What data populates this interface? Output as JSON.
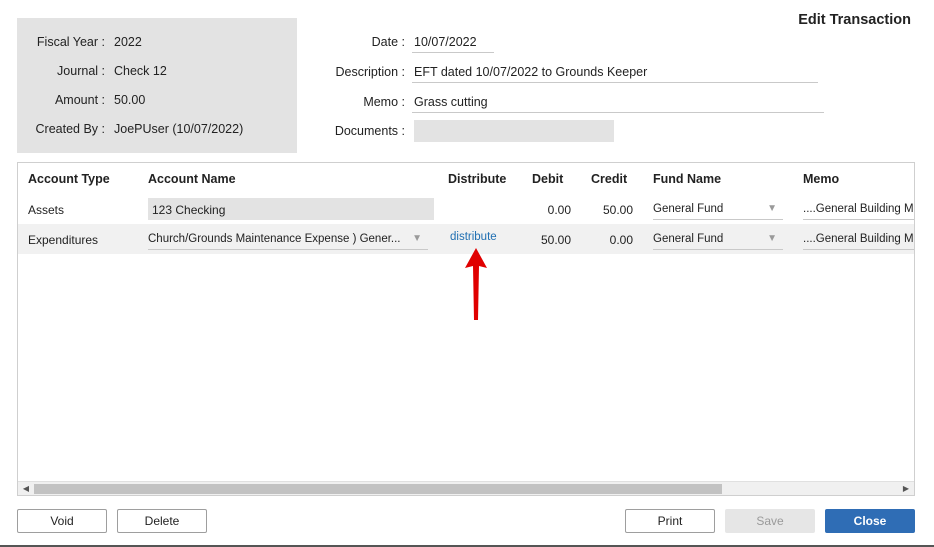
{
  "title": "Edit Transaction",
  "info": {
    "fiscal_year_label": "Fiscal Year :",
    "fiscal_year": "2022",
    "journal_label": "Journal :",
    "journal": "Check 12",
    "amount_label": "Amount :",
    "amount": "50.00",
    "created_by_label": "Created By :",
    "created_by": "JoePUser (10/07/2022)"
  },
  "form": {
    "date_label": "Date :",
    "date": "10/07/2022",
    "description_label": "Description :",
    "description": "EFT dated 10/07/2022 to Grounds Keeper",
    "memo_label": "Memo :",
    "memo": "Grass cutting",
    "documents_label": "Documents :",
    "documents": ""
  },
  "grid": {
    "columns": [
      "Account Type",
      "Account Name",
      "Distribute",
      "Debit",
      "Credit",
      "Fund Name",
      "Memo"
    ],
    "rows": [
      {
        "account_type": "Assets",
        "account_name": "123 Checking",
        "distribute": "",
        "debit": "0.00",
        "credit": "50.00",
        "fund_name": "General Fund",
        "memo": "....General Building M"
      },
      {
        "account_type": "Expenditures",
        "account_name": "Church/Grounds Maintenance Expense ) Gener...",
        "distribute": "distribute",
        "debit": "50.00",
        "credit": "0.00",
        "fund_name": "General Fund",
        "memo": "....General Building M"
      }
    ]
  },
  "buttons": {
    "void": "Void",
    "delete": "Delete",
    "print": "Print",
    "save": "Save",
    "close": "Close"
  },
  "colors": {
    "accent": "#2f6db5",
    "link": "#1f6fb2",
    "annotation_arrow": "#e00000",
    "panel_bg": "#e3e3e3"
  },
  "icons": {
    "dropdown": "chevron-down-icon",
    "scroll_left": "scroll-left-icon",
    "scroll_right": "scroll-right-icon",
    "annotation": "up-arrow-icon"
  }
}
